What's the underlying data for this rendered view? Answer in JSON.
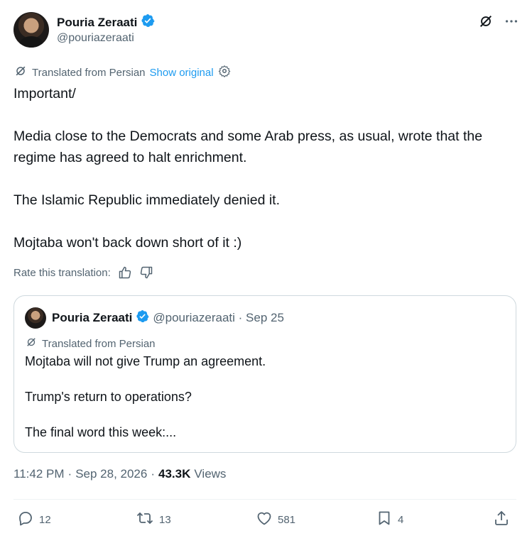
{
  "author": {
    "name": "Pouria Zeraati",
    "handle": "@pouriazeraati"
  },
  "translation": {
    "notice": "Translated from Persian",
    "show_original": "Show original"
  },
  "post": {
    "paragraphs": [
      "Important/",
      "Media close to the Democrats and some Arab press, as usual, wrote that the regime has agreed to halt enrichment.",
      "The Islamic Republic immediately denied it.",
      "Mojtaba won't back down short of it :)"
    ]
  },
  "rate": {
    "label": "Rate this translation:"
  },
  "quote": {
    "name": "Pouria Zeraati",
    "handle_date": "@pouriazeraati · Sep 25",
    "translation_notice": "Translated from Persian",
    "paragraphs": [
      "Mojtaba will not give Trump an agreement.",
      "Trump's return to operations?",
      "The final word this week:..."
    ]
  },
  "meta": {
    "time": "11:42 PM",
    "sep1": "·",
    "date": "Sep 28, 2026",
    "sep2": "·",
    "views_count": "43.3K",
    "views_label": "Views"
  },
  "actions": {
    "replies": "12",
    "reposts": "13",
    "likes": "581",
    "bookmarks": "4"
  },
  "colors": {
    "accent": "#1d9bf0",
    "text": "#0f1419",
    "muted": "#536471",
    "border": "#cfd9de"
  }
}
